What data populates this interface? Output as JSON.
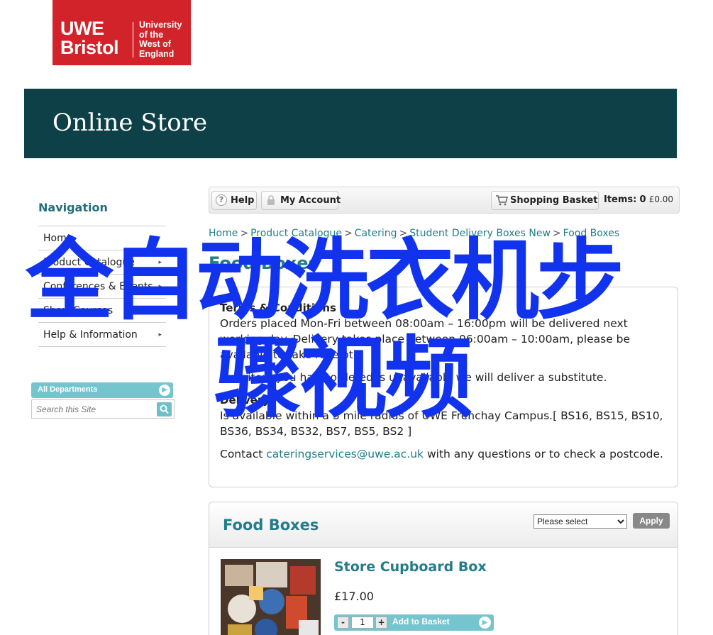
{
  "logo": {
    "line1": "UWE",
    "line2": "Bristol",
    "sub1": "University",
    "sub2": "of the",
    "sub3": "West of",
    "sub4": "England"
  },
  "banner": {
    "title": "Online Store"
  },
  "nav": {
    "heading": "Navigation",
    "items": [
      {
        "label": "Home",
        "arrow": ""
      },
      {
        "label": "Product Catalogue",
        "arrow": "▸"
      },
      {
        "label": "Conferences & Events",
        "arrow": "▸"
      },
      {
        "label": "Short Courses",
        "arrow": "▸"
      },
      {
        "label": "Help & Information",
        "arrow": "▸"
      }
    ]
  },
  "search": {
    "department": "All Departments",
    "placeholder": "Search this Site"
  },
  "toolbar": {
    "help": "Help",
    "account": "My Account",
    "basket": "Shopping Basket",
    "items_label": "Items:",
    "items_count": "0",
    "items_total": "£0.00"
  },
  "breadcrumb": [
    "Home",
    "Product Catalogue",
    "Catering",
    "Student Delivery Boxes New",
    "Food Boxes"
  ],
  "breadcrumb_sep": ">",
  "page_title": "Food Boxes",
  "terms": {
    "heading": "Terms & Conditions",
    "p1": "Orders placed Mon-Fri between 08:00am – 16:00pm will be delivered next working day. Delivery takes place between 06:00am – 10:00am, please be available to take receipt.",
    "p2": "If an item you have ordered is unavailable we will deliver a substitute.",
    "delivery_heading": "Delivery",
    "p3": "Is available within a 3 mile radius of UWE Frenchay Campus.[ BS16, BS15, BS10, BS36, BS34, BS32, BS7, BS5, BS2 ]",
    "contact_pre": "Contact ",
    "contact_email": "cateringservices@uwe.ac.uk",
    "contact_post": " with any questions or to check a postcode."
  },
  "panel": {
    "heading": "Food Boxes",
    "sort_selected": "Please select",
    "apply": "Apply"
  },
  "product": {
    "name": "Store Cupboard Box",
    "price": "£17.00",
    "qty": "1",
    "minus": "-",
    "plus": "+",
    "add": "Add to Basket"
  },
  "overlay": {
    "line1": "全自动洗衣机步",
    "line2": "骤视频"
  },
  "colors": {
    "brand_red": "#d2232a",
    "banner": "#0d4047",
    "accent": "#237c8a",
    "teal_button": "#75c5cf",
    "overlay_blue": "#1133ee"
  }
}
